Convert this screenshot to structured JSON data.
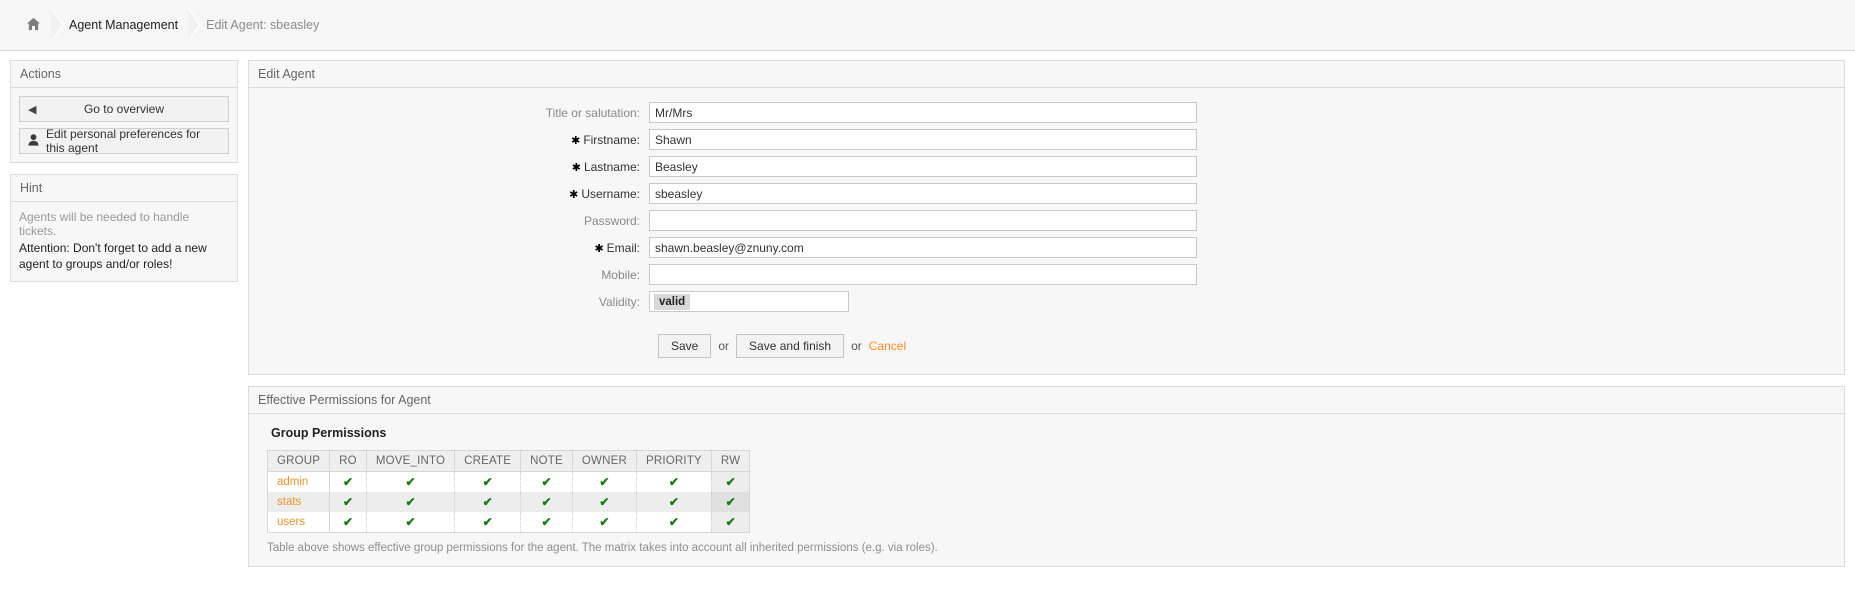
{
  "breadcrumb": {
    "home_icon": "home-icon",
    "items": [
      {
        "label": "Agent Management",
        "current": false
      },
      {
        "label": "Edit Agent: sbeasley",
        "current": true
      }
    ]
  },
  "sidebar": {
    "actions": {
      "title": "Actions",
      "buttons": [
        {
          "icon": "left-arrow-icon",
          "glyph": "◀",
          "label": "Go to overview",
          "name": "go-to-overview-button"
        },
        {
          "icon": "user-icon",
          "glyph": "A",
          "label": "Edit personal preferences for this agent",
          "name": "edit-personal-preferences-button"
        }
      ]
    },
    "hint": {
      "title": "Hint",
      "line1": "Agents will be needed to handle tickets.",
      "line2": "Attention: Don't forget to add a new agent to groups and/or roles!"
    }
  },
  "form": {
    "title": "Edit Agent",
    "fields": [
      {
        "label": "Title or salutation:",
        "required": false,
        "value": "Mr/Mrs",
        "name": "title-salutation-field",
        "type": "text"
      },
      {
        "label": "Firstname:",
        "required": true,
        "value": "Shawn",
        "name": "firstname-field",
        "type": "text"
      },
      {
        "label": "Lastname:",
        "required": true,
        "value": "Beasley",
        "name": "lastname-field",
        "type": "text"
      },
      {
        "label": "Username:",
        "required": true,
        "value": "sbeasley",
        "name": "username-field",
        "type": "text"
      },
      {
        "label": "Password:",
        "required": false,
        "value": "",
        "name": "password-field",
        "type": "password"
      },
      {
        "label": "Email:",
        "required": true,
        "value": "shawn.beasley@znuny.com",
        "name": "email-field",
        "type": "text"
      },
      {
        "label": "Mobile:",
        "required": false,
        "value": "",
        "name": "mobile-field",
        "type": "text"
      },
      {
        "label": "Validity:",
        "required": false,
        "value": "valid",
        "name": "validity-select",
        "type": "select"
      }
    ],
    "buttons": {
      "save_label": "Save",
      "or_label_1": "or",
      "save_and_finish_label": "Save and finish",
      "or_label_2": "or",
      "cancel_label": "Cancel"
    }
  },
  "permissions": {
    "widget_title": "Effective Permissions for Agent",
    "section_title": "Group Permissions",
    "columns": [
      "GROUP",
      "RO",
      "MOVE_INTO",
      "CREATE",
      "NOTE",
      "OWNER",
      "PRIORITY",
      "RW"
    ],
    "rows": [
      {
        "group": "admin",
        "RO": true,
        "MOVE_INTO": true,
        "CREATE": true,
        "NOTE": true,
        "OWNER": true,
        "PRIORITY": true,
        "RW": true
      },
      {
        "group": "stats",
        "RO": true,
        "MOVE_INTO": true,
        "CREATE": true,
        "NOTE": true,
        "OWNER": true,
        "PRIORITY": true,
        "RW": true
      },
      {
        "group": "users",
        "RO": true,
        "MOVE_INTO": true,
        "CREATE": true,
        "NOTE": true,
        "OWNER": true,
        "PRIORITY": true,
        "RW": true
      }
    ],
    "check_glyph": "✔",
    "note": "Table above shows effective group permissions for the agent. The matrix takes into account all inherited permissions (e.g. via roles)."
  },
  "colors": {
    "accent_orange": "#ff8c1a",
    "group_link_orange": "#f0932b",
    "check_green": "#1a7a1a",
    "panel_bg": "#f7f7f7",
    "border": "#dcdcdc"
  }
}
